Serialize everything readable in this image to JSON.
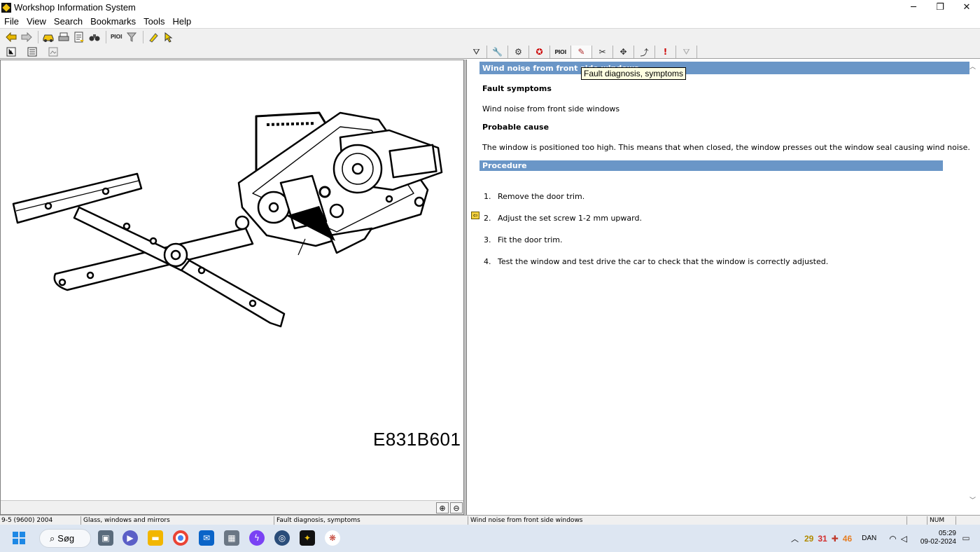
{
  "window": {
    "title": "Workshop Information System",
    "minimize": "─",
    "maximize": "❐",
    "close": "✕"
  },
  "menu": [
    "File",
    "View",
    "Search",
    "Bookmarks",
    "Tools",
    "Help"
  ],
  "toolbar": {
    "pioi_label": "PIOI"
  },
  "tabs": {
    "pioi_label": "PIOI"
  },
  "tooltip": "Fault diagnosis, symptoms",
  "figure": {
    "code": "E831B601"
  },
  "document": {
    "title": "Wind noise from front side windows",
    "fault_symptoms_heading": "Fault symptoms",
    "fault_symptoms_text": "Wind noise from front side windows",
    "probable_cause_heading": "Probable cause",
    "probable_cause_text": "The window is positioned too high. This means that when closed, the window presses out the window seal causing wind noise.",
    "procedure_heading": "Procedure",
    "steps": [
      {
        "num": "1.",
        "text": "Remove the door trim."
      },
      {
        "num": "2.",
        "text": "Adjust the set screw 1-2 mm upward."
      },
      {
        "num": "3.",
        "text": "Fit the door trim."
      },
      {
        "num": "4.",
        "text": "Test the window and test drive the car to check that the window is correctly adjusted."
      }
    ]
  },
  "statusbar": {
    "model": "9-5 (9600) 2004",
    "section": "Glass, windows and mirrors",
    "category": "Fault diagnosis, symptoms",
    "document": "Wind noise from front side windows",
    "num": "NUM"
  },
  "taskbar": {
    "search_label": "Søg",
    "tray_numbers": [
      "29",
      "31",
      "46"
    ],
    "language": "DAN",
    "time": "05:29",
    "date": "09-02-2024"
  }
}
